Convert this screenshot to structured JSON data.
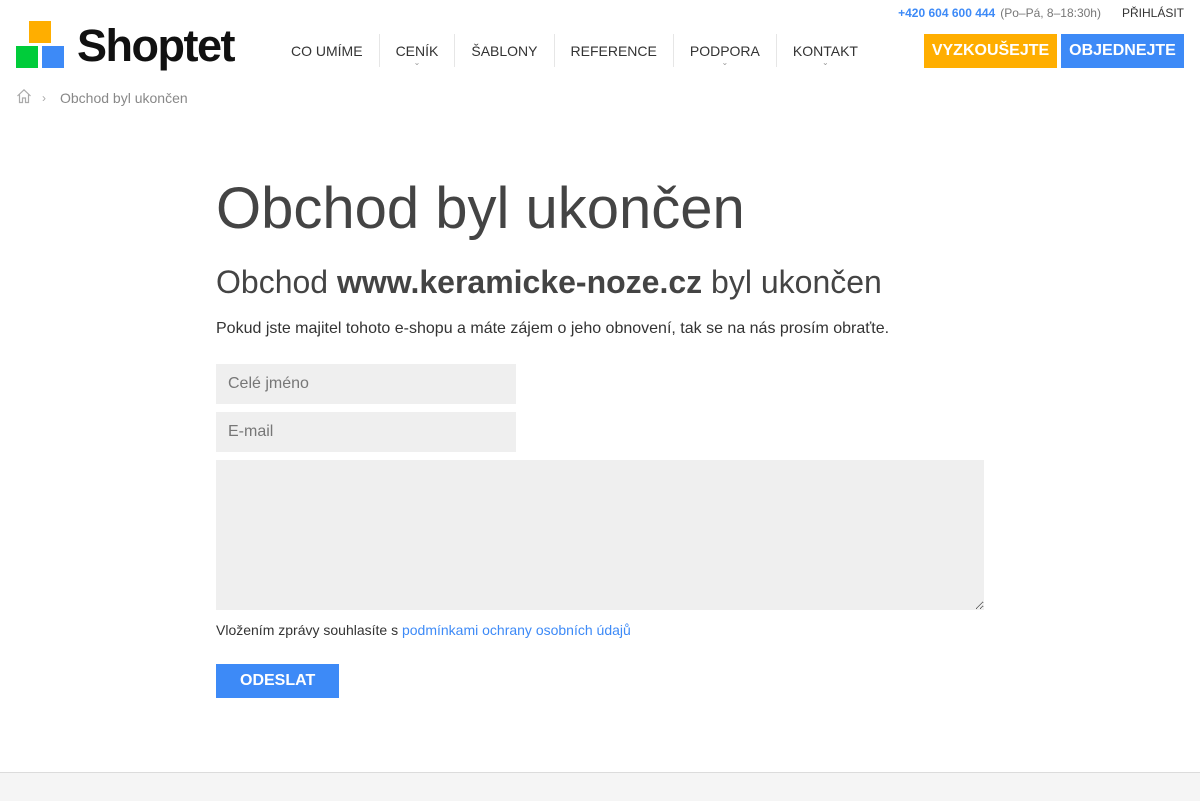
{
  "topbar": {
    "phone": "+420 604 600 444",
    "hours": "(Po–Pá, 8–18:30h)",
    "login": "PŘIHLÁSIT"
  },
  "brand": {
    "name": "Shoptet"
  },
  "nav": {
    "items": [
      {
        "label": "CO UMÍME",
        "dropdown": false
      },
      {
        "label": "CENÍK",
        "dropdown": true
      },
      {
        "label": "ŠABLONY",
        "dropdown": false
      },
      {
        "label": "REFERENCE",
        "dropdown": false
      },
      {
        "label": "PODPORA",
        "dropdown": true
      },
      {
        "label": "KONTAKT",
        "dropdown": true
      }
    ],
    "chevron_glyph": "⌄"
  },
  "cta": {
    "try": "VYZKOUŠEJTE",
    "order": "OBJEDNEJTE"
  },
  "breadcrumb": {
    "current": "Obchod byl ukončen",
    "separator": "›"
  },
  "main": {
    "title": "Obchod byl ukončen",
    "subtitle_prefix": "Obchod ",
    "subtitle_domain": "www.keramicke-noze.cz",
    "subtitle_suffix": " byl ukončen",
    "intro": "Pokud jste majitel tohoto e-shopu a máte zájem o jeho obnovení, tak se na nás prosím obraťte."
  },
  "form": {
    "name_placeholder": "Celé jméno",
    "name_value": "",
    "email_placeholder": "E-mail",
    "email_value": "",
    "message_value": "",
    "consent_text": "Vložením zprávy souhlasíte s ",
    "consent_link": "podmínkami ochrany osobních údajů",
    "submit_label": "ODESLAT"
  },
  "colors": {
    "accent_blue": "#3d8af7",
    "accent_orange": "#ffae00",
    "logo_green": "#00cc3a"
  }
}
